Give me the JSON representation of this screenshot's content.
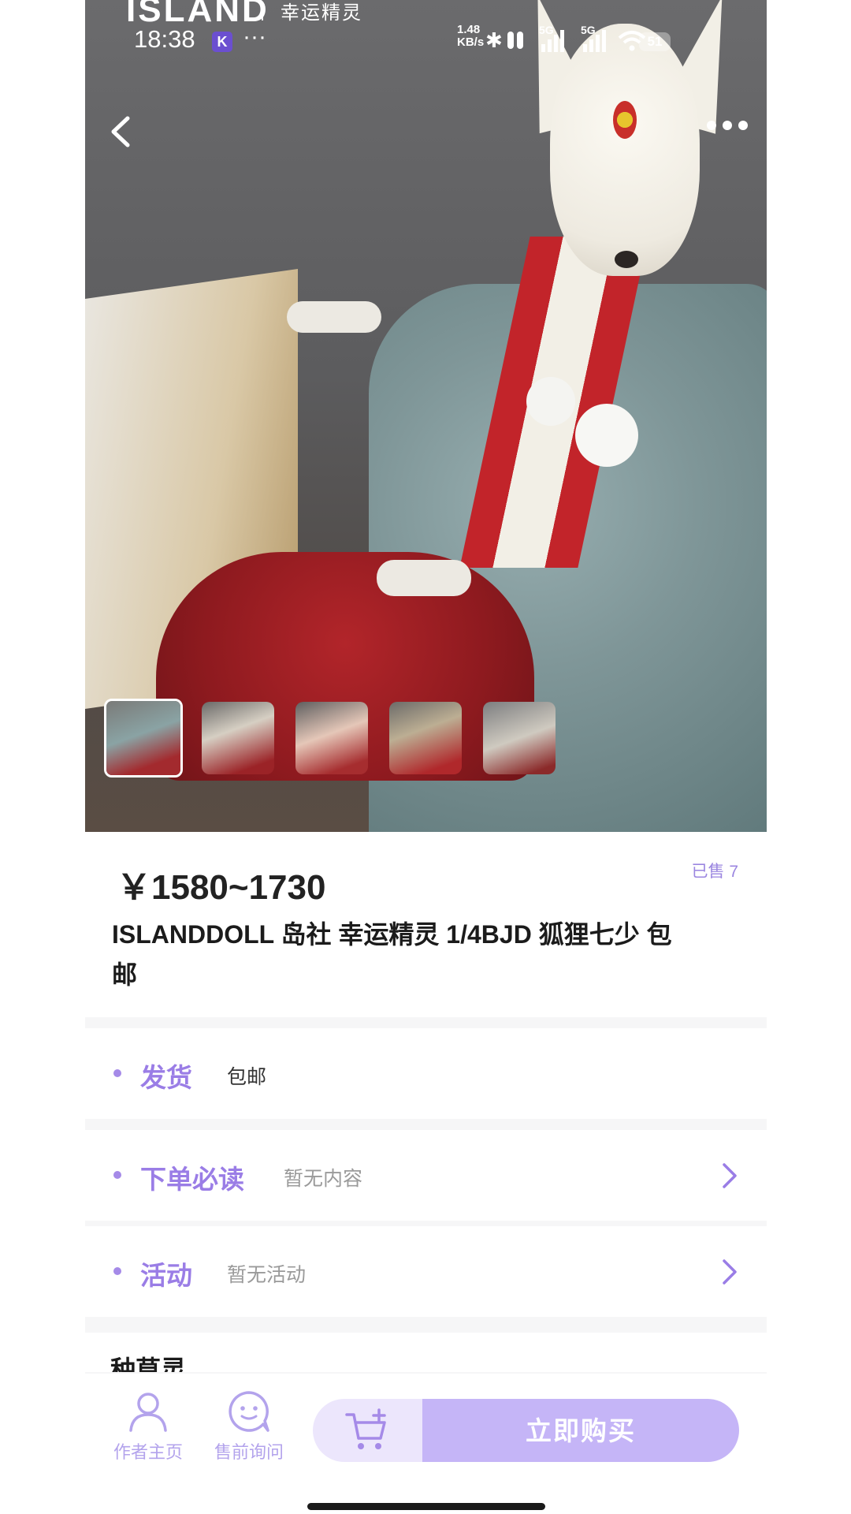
{
  "status_bar": {
    "time": "18:38",
    "app_badge": "K",
    "dots": "···",
    "net_speed_value": "1.48",
    "net_speed_unit": "KB/s",
    "network_1": "5G",
    "network_2": "5G",
    "battery": "51"
  },
  "watermark": {
    "brand": "ISLAND",
    "subtitle": "幸运精灵"
  },
  "gallery": {
    "thumbnail_count": 5,
    "active_index": 0
  },
  "product": {
    "price": "￥1580~1730",
    "sold": "已售 7",
    "title": "ISLANDDOLL 岛社 幸运精灵 1/4BJD 狐狸七少 包邮"
  },
  "rows": {
    "shipping": {
      "label": "发货",
      "value": "包邮"
    },
    "notice": {
      "label": "下单必读",
      "value": "暂无内容"
    },
    "activity": {
      "label": "活动",
      "value": "暂无活动"
    },
    "next_section_peek": "种草灵"
  },
  "bottom_bar": {
    "author_home": "作者主页",
    "presale_inquiry": "售前询问",
    "buy_now": "立即购买"
  },
  "colors": {
    "accent": "#9a7de6",
    "buy_button": "#c5b5f7",
    "cart_button": "#ece6fc"
  }
}
